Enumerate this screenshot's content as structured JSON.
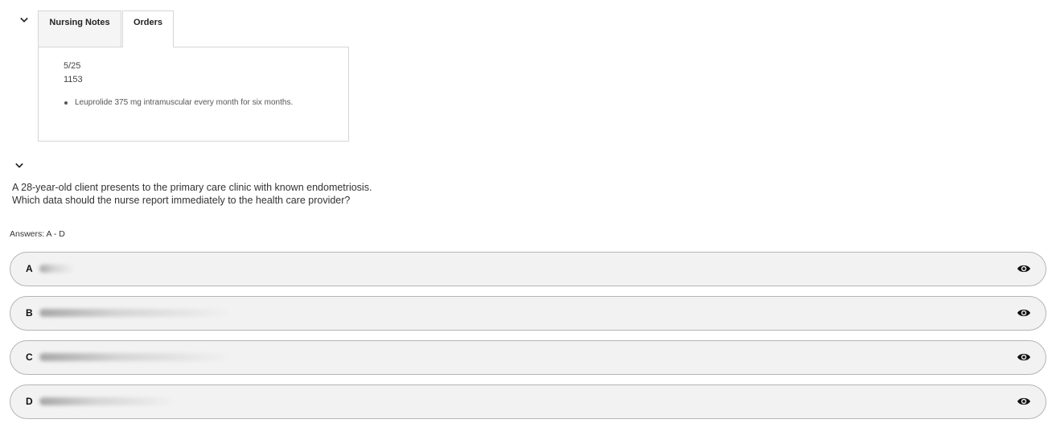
{
  "tabs": [
    {
      "label": "Nursing Notes"
    },
    {
      "label": "Orders"
    }
  ],
  "order": {
    "date": "5/25",
    "time": "1153",
    "items": [
      "Leuprolide 375 mg intramuscular every month for six months."
    ]
  },
  "question": {
    "line1": "A 28-year-old client presents to the primary care clinic with known endometriosis.",
    "line2": "Which data should the nurse report immediately to the health care provider?"
  },
  "answers_label": "Answers: A - D",
  "answers": [
    {
      "letter": "A",
      "icon": "eye-icon"
    },
    {
      "letter": "B",
      "icon": "eye-icon"
    },
    {
      "letter": "C",
      "icon": "eye-icon"
    },
    {
      "letter": "D",
      "icon": "eye-icon"
    }
  ],
  "colors": {
    "answer_bg": "#f2f2f2",
    "answer_border": "#b5b5b5",
    "tab_inactive_bg": "#f5f5f5"
  }
}
